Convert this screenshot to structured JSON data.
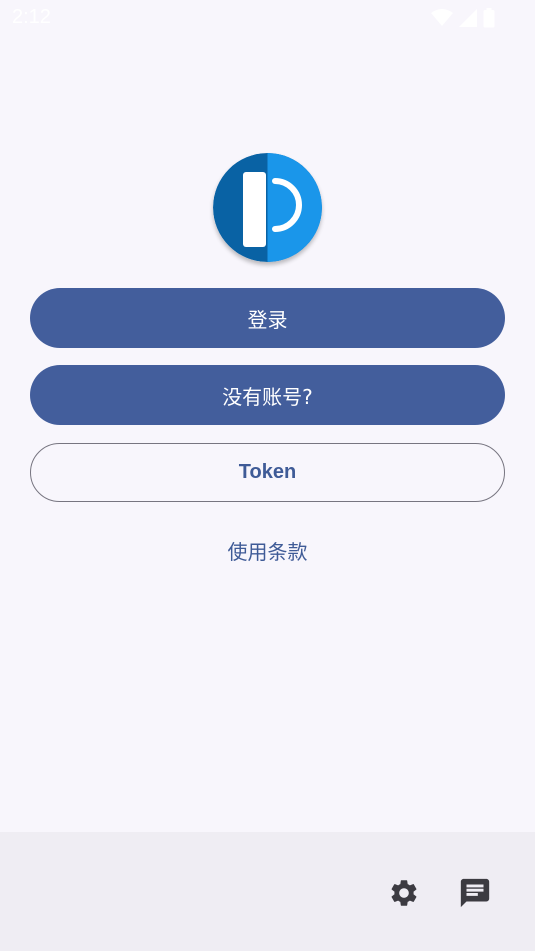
{
  "status_bar": {
    "time": "2:12"
  },
  "actions": {
    "login_label": "登录",
    "register_label": "没有账号?",
    "token_label": "Token",
    "terms_label": "使用条款"
  },
  "icons": {
    "logo": "app-logo-icon",
    "settings": "gear-icon",
    "message": "message-icon"
  },
  "colors": {
    "primary": "#435e9c",
    "text_accent": "#3f5b97",
    "background": "#f8f6fc",
    "bottom_bar": "#efedf3",
    "logo_dark": "#0962a4",
    "logo_light": "#1a96ea"
  }
}
